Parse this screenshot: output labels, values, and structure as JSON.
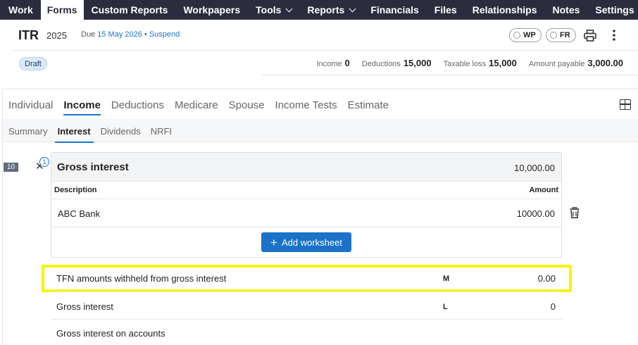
{
  "nav": {
    "items": [
      {
        "label": "Work",
        "dropdown": false,
        "active": false
      },
      {
        "label": "Forms",
        "dropdown": false,
        "active": true
      },
      {
        "label": "Custom Reports",
        "dropdown": false,
        "active": false
      },
      {
        "label": "Workpapers",
        "dropdown": false,
        "active": false
      },
      {
        "label": "Tools",
        "dropdown": true,
        "active": false
      },
      {
        "label": "Reports",
        "dropdown": true,
        "active": false
      },
      {
        "label": "Financials",
        "dropdown": false,
        "active": false
      },
      {
        "label": "Files",
        "dropdown": false,
        "active": false
      },
      {
        "label": "Relationships",
        "dropdown": false,
        "active": false
      },
      {
        "label": "Notes",
        "dropdown": false,
        "active": false
      },
      {
        "label": "Settings",
        "dropdown": true,
        "active": false
      }
    ]
  },
  "header": {
    "form": "ITR",
    "year": "2025",
    "due_prefix": "Due",
    "due_date": "15 May 2026",
    "separator": "•",
    "suspend": "Suspend",
    "wp_label": "WP",
    "fr_label": "FR",
    "print_icon": "printer-icon",
    "more_icon": "more-vertical-icon"
  },
  "status": {
    "badge": "Draft",
    "income_label": "Income",
    "income_value": "0",
    "deductions_label": "Deductions",
    "deductions_value": "15,000",
    "taxable_label": "Taxable loss",
    "taxable_value": "15,000",
    "payable_label": "Amount payable",
    "payable_value": "3,000.00"
  },
  "tabs": [
    {
      "label": "Individual",
      "active": false
    },
    {
      "label": "Income",
      "active": true
    },
    {
      "label": "Deductions",
      "active": false
    },
    {
      "label": "Medicare",
      "active": false
    },
    {
      "label": "Spouse",
      "active": false
    },
    {
      "label": "Income Tests",
      "active": false
    },
    {
      "label": "Estimate",
      "active": false
    }
  ],
  "subtabs": [
    {
      "label": "Summary",
      "active": false
    },
    {
      "label": "Interest",
      "active": true
    },
    {
      "label": "Dividends",
      "active": false
    },
    {
      "label": "NRFI",
      "active": false
    }
  ],
  "section": {
    "number": "10",
    "badge_count": "1",
    "title": "Gross interest",
    "total": "10,000.00",
    "col_description": "Description",
    "col_amount": "Amount",
    "row_description": "ABC Bank",
    "row_amount": "10000.00",
    "add_button": "Add worksheet"
  },
  "fields": [
    {
      "label": "TFN amounts withheld from gross interest",
      "code": "M",
      "value": "0.00"
    },
    {
      "label": "Gross interest",
      "code": "L",
      "value": "0"
    },
    {
      "label": "Gross interest on accounts",
      "code": "",
      "value": ""
    }
  ],
  "colors": {
    "nav_bg": "#2b2d3e",
    "accent": "#1a73c8",
    "highlight": "#f5f500"
  }
}
